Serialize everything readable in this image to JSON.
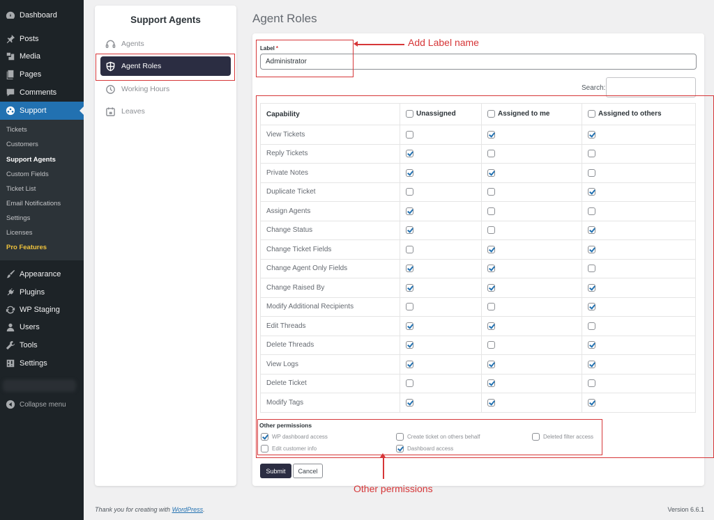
{
  "wp_menu": {
    "items": [
      {
        "label": "Dashboard",
        "icon": "dashboard-icon"
      },
      {
        "label": "Posts",
        "icon": "pushpin-icon"
      },
      {
        "label": "Media",
        "icon": "media-icon"
      },
      {
        "label": "Pages",
        "icon": "pages-icon"
      },
      {
        "label": "Comments",
        "icon": "comment-icon"
      },
      {
        "label": "Support",
        "icon": "support-icon",
        "active": true
      },
      {
        "label": "Appearance",
        "icon": "paintbrush-icon"
      },
      {
        "label": "Plugins",
        "icon": "plug-icon"
      },
      {
        "label": "WP Staging",
        "icon": "refresh-icon"
      },
      {
        "label": "Users",
        "icon": "user-icon"
      },
      {
        "label": "Tools",
        "icon": "wrench-icon"
      },
      {
        "label": "Settings",
        "icon": "settings-icon"
      }
    ],
    "submenu": [
      {
        "label": "Tickets"
      },
      {
        "label": "Customers"
      },
      {
        "label": "Support Agents",
        "current": true
      },
      {
        "label": "Custom Fields"
      },
      {
        "label": "Ticket List"
      },
      {
        "label": "Email Notifications"
      },
      {
        "label": "Settings"
      },
      {
        "label": "Licenses"
      },
      {
        "label": "Pro Features",
        "highlight": true
      }
    ],
    "collapse_label": "Collapse menu"
  },
  "panel": {
    "title": "Support Agents",
    "items": [
      {
        "label": "Agents",
        "icon": "headset-icon"
      },
      {
        "label": "Agent Roles",
        "icon": "role-icon",
        "active": true
      },
      {
        "label": "Working Hours",
        "icon": "clock-icon"
      },
      {
        "label": "Leaves",
        "icon": "calendar-icon"
      }
    ]
  },
  "page": {
    "title": "Agent Roles",
    "label_caption": "Label",
    "required_mark": "*",
    "label_value": "Administrator",
    "search_label": "Search:",
    "search_value": ""
  },
  "table": {
    "headers": [
      "Capability",
      "Unassigned",
      "Assigned to me",
      "Assigned to others"
    ],
    "header_checked": [
      false,
      false,
      false
    ],
    "rows": [
      {
        "capability": "View Tickets",
        "values": [
          false,
          true,
          true
        ]
      },
      {
        "capability": "Reply Tickets",
        "values": [
          true,
          false,
          false
        ]
      },
      {
        "capability": "Private Notes",
        "values": [
          true,
          true,
          false
        ]
      },
      {
        "capability": "Duplicate Ticket",
        "values": [
          false,
          false,
          true
        ]
      },
      {
        "capability": "Assign Agents",
        "values": [
          true,
          false,
          false
        ]
      },
      {
        "capability": "Change Status",
        "values": [
          true,
          false,
          true
        ]
      },
      {
        "capability": "Change Ticket Fields",
        "values": [
          false,
          true,
          true
        ]
      },
      {
        "capability": "Change Agent Only Fields",
        "values": [
          true,
          true,
          false
        ]
      },
      {
        "capability": "Change Raised By",
        "values": [
          true,
          true,
          true
        ]
      },
      {
        "capability": "Modify Additional Recipients",
        "values": [
          false,
          false,
          true
        ]
      },
      {
        "capability": "Edit Threads",
        "values": [
          true,
          true,
          false
        ]
      },
      {
        "capability": "Delete Threads",
        "values": [
          true,
          false,
          true
        ]
      },
      {
        "capability": "View Logs",
        "values": [
          true,
          true,
          true
        ]
      },
      {
        "capability": "Delete Ticket",
        "values": [
          false,
          true,
          false
        ]
      },
      {
        "capability": "Modify Tags",
        "values": [
          true,
          true,
          true
        ]
      }
    ]
  },
  "other_permissions": {
    "title": "Other permissions",
    "items": [
      {
        "label": "WP dashboard access",
        "checked": true
      },
      {
        "label": "Create ticket on others behalf",
        "checked": false
      },
      {
        "label": "Deleted filter access",
        "checked": false
      },
      {
        "label": "Edit customer info",
        "checked": false
      },
      {
        "label": "Dashboard access",
        "checked": true
      }
    ]
  },
  "buttons": {
    "submit": "Submit",
    "cancel": "Cancel"
  },
  "annotations": {
    "label_note": "Add Label name",
    "permissions_note": "Other permissions",
    "color": "#d63638"
  },
  "footer": {
    "thanks_prefix": "Thank you for creating with ",
    "wordpress_link": "WordPress",
    "thanks_suffix": ".",
    "version": "Version 6.6.1"
  }
}
